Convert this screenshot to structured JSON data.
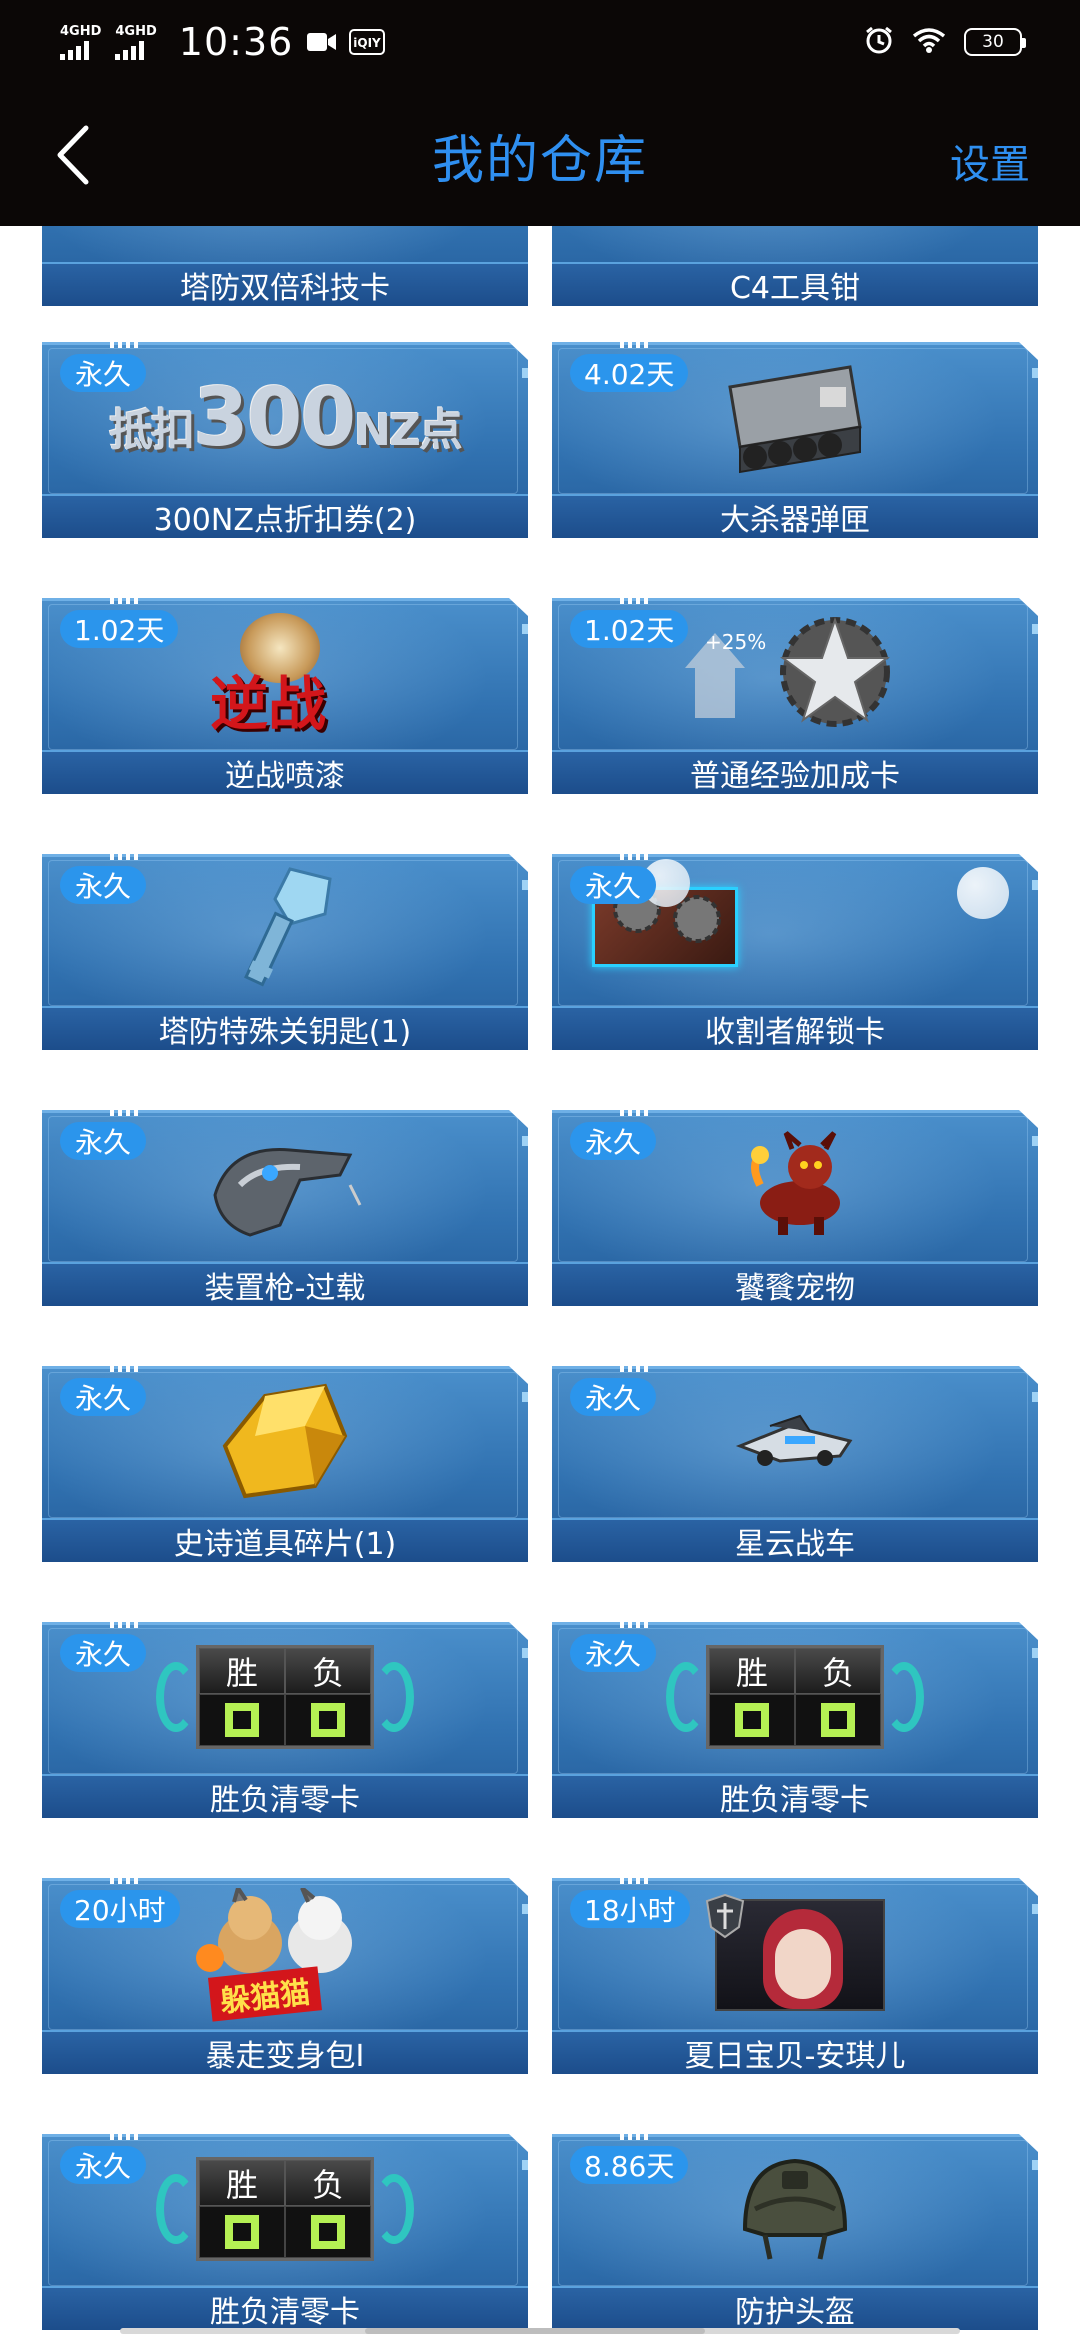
{
  "status_bar": {
    "signal1": "4GHD",
    "signal2": "4GHD",
    "time": "10:36",
    "battery": "30",
    "icons": [
      "video-icon",
      "iqiyi-icon",
      "alarm-icon",
      "wifi-icon"
    ]
  },
  "nav": {
    "title": "我的仓库",
    "settings_label": "设置",
    "back_icon": "back-arrow-icon"
  },
  "items": [
    {
      "name": "塔防双倍科技卡",
      "badge": ""
    },
    {
      "name": "C4工具钳",
      "badge": ""
    },
    {
      "name": "300NZ点折扣券(2)",
      "badge": "永久",
      "art_text_a": "抵扣",
      "art_text_b": "300",
      "art_text_c": "NZ点"
    },
    {
      "name": "大杀器弹匣",
      "badge": "4.02天"
    },
    {
      "name": "逆战喷漆",
      "badge": "1.02天",
      "art_text": "逆战"
    },
    {
      "name": "普通经验加成卡",
      "badge": "1.02天",
      "art_text": "+25%"
    },
    {
      "name": "塔防特殊关钥匙(1)",
      "badge": "永久"
    },
    {
      "name": "收割者解锁卡",
      "badge": "永久"
    },
    {
      "name": "装置枪-过载",
      "badge": "永久"
    },
    {
      "name": "饕餮宠物",
      "badge": "永久"
    },
    {
      "name": "史诗道具碎片(1)",
      "badge": "永久"
    },
    {
      "name": "星云战车",
      "badge": "永久"
    },
    {
      "name": "胜负清零卡",
      "badge": "永久",
      "win": "胜",
      "lose": "负"
    },
    {
      "name": "胜负清零卡",
      "badge": "永久",
      "win": "胜",
      "lose": "负"
    },
    {
      "name": "暴走变身包I",
      "badge": "20小时",
      "art_text": "躲猫猫"
    },
    {
      "name": "夏日宝贝-安琪儿",
      "badge": "18小时"
    },
    {
      "name": "胜负清零卡",
      "badge": "永久",
      "win": "胜",
      "lose": "负"
    },
    {
      "name": "防护头盔",
      "badge": "8.86天"
    }
  ],
  "colors": {
    "accent": "#2f8ff0",
    "card_blue": "#3172b1",
    "badge_blue": "#2b95ec",
    "header_bg": "#0b0706"
  }
}
